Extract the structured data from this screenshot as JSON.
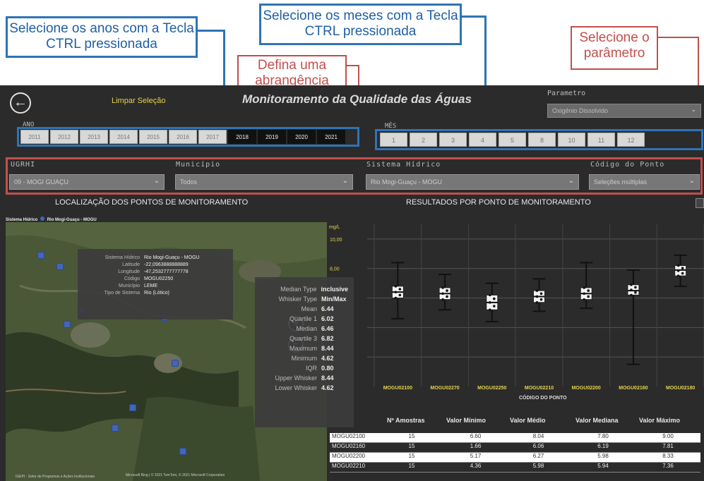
{
  "callouts": {
    "years": "Selecione os anos com a Tecla CTRL pressionada",
    "months": "Selecione os meses com a Tecla CTRL pressionada",
    "scope": "Defina uma abrangência",
    "param": "Selecione o parâmetro"
  },
  "header": {
    "back_icon": "back-arrow-icon",
    "clear_label": "Limpar Seleção",
    "title": "Monitoramento da Qualidade das Águas",
    "param_label": "Parametro",
    "param_value": "Oxigênio Dissolvido"
  },
  "years": {
    "label": "ANO",
    "items": [
      "2011",
      "2012",
      "2013",
      "2014",
      "2015",
      "2016",
      "2017",
      "2018",
      "2019",
      "2020",
      "2021"
    ],
    "selected": [
      "2018",
      "2019",
      "2020",
      "2021"
    ]
  },
  "months": {
    "label": "MÊS",
    "items": [
      "1",
      "2",
      "3",
      "4",
      "5",
      "8",
      "10",
      "11",
      "12"
    ]
  },
  "filters": {
    "ugrhi": {
      "label": "UGRHI",
      "value": "09 - MOGI GUAÇU"
    },
    "municipio": {
      "label": "Município",
      "value": "Todos"
    },
    "sistema": {
      "label": "Sistema Hídrico",
      "value": "Rio Mogi-Guaçu - MOGU"
    },
    "codigo": {
      "label": "Código do Ponto",
      "value": "Seleções múltiplas"
    }
  },
  "map": {
    "title": "LOCALIZAÇÃO DOS PONTOS DE MONITORAMENTO",
    "legend_label": "Sistema Hídrico",
    "legend_value": "Rio Mogi-Guaçu - MOGU",
    "tooltip": [
      {
        "k": "Sistema Hídrico",
        "v": "Rio Mogi-Guaçu - MOGU"
      },
      {
        "k": "Latitude",
        "v": "-22,0963888888889"
      },
      {
        "k": "Longitude",
        "v": "-47,2532777777778"
      },
      {
        "k": "Código",
        "v": "MOGU02250"
      },
      {
        "k": "Município",
        "v": "LEME"
      },
      {
        "k": "Tipo de Sistema",
        "v": "Rio (Lótico)"
      }
    ],
    "footer": "IGEPI - Setor de Programas e Ações Institucionais",
    "attribution": "Microsoft Bing | © 2021 TomTom, © 2021 Microsoft Corporation"
  },
  "box_tooltip": [
    {
      "k": "Median Type",
      "v": "inclusive"
    },
    {
      "k": "Whisker Type",
      "v": "Min/Max"
    },
    {
      "k": "Mean",
      "v": "6.44"
    },
    {
      "k": "Quartile 1",
      "v": "6.02"
    },
    {
      "k": "Median",
      "v": "6.46"
    },
    {
      "k": "Quartile 3",
      "v": "6.82"
    },
    {
      "k": "Maximum",
      "v": "8.44"
    },
    {
      "k": "Minimum",
      "v": "4.62"
    },
    {
      "k": "IQR",
      "v": "0.80"
    },
    {
      "k": "Upper Whisker",
      "v": "8.44"
    },
    {
      "k": "Lower Whisker",
      "v": "4.62"
    }
  ],
  "chart_data": {
    "type": "box",
    "title": "RESULTADOS POR PONTO DE MONITORAMENTO",
    "ylabel": "mg/L",
    "xlabel": "CÓDIGO DO PONTO",
    "yticks": [
      "10,00",
      "8,00"
    ],
    "ylim": [
      0,
      11
    ],
    "categories": [
      "MOGU02100",
      "MOGU02270",
      "MOGU02250",
      "MOGU02210",
      "MOGU02200",
      "MOGU02160",
      "MOGU02180"
    ],
    "boxes": [
      {
        "min": 4.6,
        "q1": 6.0,
        "median": 6.4,
        "q3": 6.8,
        "max": 8.4
      },
      {
        "min": 5.2,
        "q1": 5.9,
        "median": 6.3,
        "q3": 6.7,
        "max": 7.6
      },
      {
        "min": 4.4,
        "q1": 5.2,
        "median": 5.7,
        "q3": 6.2,
        "max": 7.0
      },
      {
        "min": 5.1,
        "q1": 5.7,
        "median": 6.1,
        "q3": 6.5,
        "max": 7.3
      },
      {
        "min": 5.3,
        "q1": 5.9,
        "median": 6.3,
        "q3": 6.7,
        "max": 8.4
      },
      {
        "min": 1.5,
        "q1": 6.2,
        "median": 6.5,
        "q3": 6.9,
        "max": 7.9
      },
      {
        "min": 6.8,
        "q1": 7.5,
        "median": 7.9,
        "q3": 8.2,
        "max": 8.9
      }
    ]
  },
  "table": {
    "headers": [
      "Nº Amostras",
      "Valor Mínimo",
      "Valor Médio",
      "Valor Mediana",
      "Valor Máximo"
    ],
    "rows": [
      {
        "code": "MOGU02100",
        "n": "15",
        "min": "6.60",
        "mean": "8.04",
        "median": "7.80",
        "max": "9.00"
      },
      {
        "code": "MOGU02160",
        "n": "15",
        "min": "1.66",
        "mean": "6.06",
        "median": "6.19",
        "max": "7.81"
      },
      {
        "code": "MOGU02200",
        "n": "15",
        "min": "5.17",
        "mean": "6.27",
        "median": "5.98",
        "max": "8.33"
      },
      {
        "code": "MOGU02210",
        "n": "15",
        "min": "4.36",
        "mean": "5.98",
        "median": "5.94",
        "max": "7.36"
      }
    ]
  }
}
